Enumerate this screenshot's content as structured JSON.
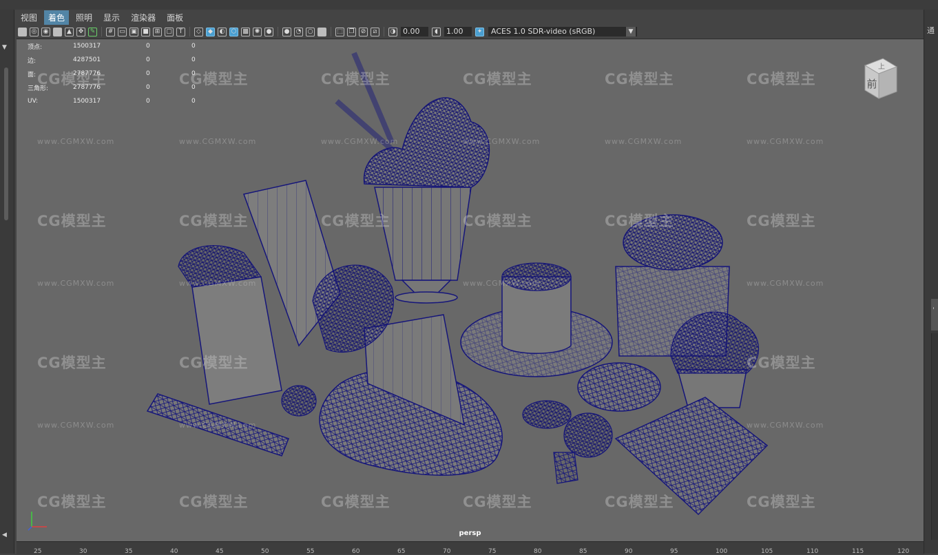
{
  "menu": [
    {
      "label": "视图",
      "active": false
    },
    {
      "label": "着色",
      "active": true
    },
    {
      "label": "照明",
      "active": false
    },
    {
      "label": "显示",
      "active": false
    },
    {
      "label": "渲染器",
      "active": false
    },
    {
      "label": "面板",
      "active": false
    }
  ],
  "toolbar": {
    "exposure": "0.00",
    "gamma": "1.00",
    "color_space": "ACES 1.0 SDR-video (sRGB)"
  },
  "hud": {
    "rows": [
      {
        "label": "顶点:",
        "v1": "1500317",
        "v2": "0",
        "v3": "0"
      },
      {
        "label": "边:",
        "v1": "4287501",
        "v2": "0",
        "v3": "0"
      },
      {
        "label": "面:",
        "v1": "2787776",
        "v2": "0",
        "v3": "0"
      },
      {
        "label": "三角形:",
        "v1": "2787776",
        "v2": "0",
        "v3": "0"
      },
      {
        "label": "UV:",
        "v1": "1500317",
        "v2": "0",
        "v3": "0"
      }
    ]
  },
  "watermark": {
    "logo": "CG模型主",
    "url": "www.CGMXW.com"
  },
  "camera_label": "persp",
  "viewcube": {
    "top": "上",
    "front": "前"
  },
  "ruler_ticks": [
    "25",
    "30",
    "35",
    "40",
    "45",
    "50",
    "55",
    "60",
    "65",
    "70",
    "75",
    "80",
    "85",
    "90",
    "95",
    "100",
    "105",
    "110",
    "115",
    "120"
  ],
  "right_panel_text": "通",
  "colors": {
    "wireframe": "#15157a",
    "viewport_bg": "#686868",
    "active_menu": "#5285a6"
  }
}
